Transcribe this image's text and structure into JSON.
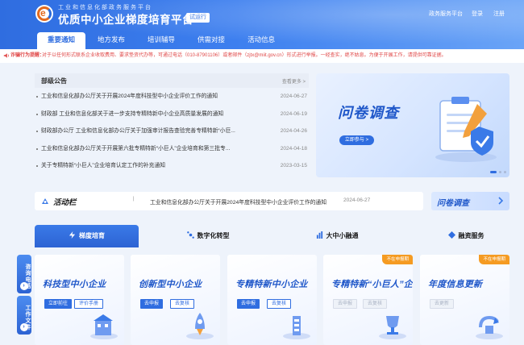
{
  "header": {
    "sup_title": "工业和信息化部政务服务平台",
    "title": "优质中小企业梯度培育平台",
    "badge": "试运行",
    "links": [
      "政务服务平台",
      "登录",
      "注册"
    ]
  },
  "nav": {
    "tabs": [
      "重要通知",
      "地方发布",
      "培训辅导",
      "供需对接",
      "活动信息"
    ],
    "active_index": 0
  },
  "notice": {
    "label": "诈骗行为提醒：",
    "text": "对于以任何形式联系企业收取费用、要求垫资代办等，可通过电话（010-87901106）或者邮件（zjtx@miit.gov.cn）形式进行举报。一经查实，绝不姑息。为便于开展工作，请提供可靠证据。"
  },
  "announcements": {
    "title": "部级公告",
    "more": "查看更多 >",
    "items": [
      {
        "title": "工业和信息化部办公厅关于开展2024年度科技型中小企业评价工作的通知",
        "date": "2024-06-27"
      },
      {
        "title": "财政部 工业和信息化部关于进一步支持专精特新中小企业高质量发展的通知",
        "date": "2024-06-19"
      },
      {
        "title": "财政部办公厅 工业和信息化部办公厅关于加强审计报告查验完善专精特新“小巨...",
        "date": "2024-04-26"
      },
      {
        "title": "工业和信息化部办公厅关于开展第六批专精特新“小巨人”企业培育和第三批专...",
        "date": "2024-04-18"
      },
      {
        "title": "关于专精特新“小巨人”企业培育认定工作的补充通知",
        "date": "2023-03-15"
      }
    ]
  },
  "banner": {
    "title": "问卷调查",
    "button": "立即参与 >",
    "slides": 3,
    "active_slide": 0
  },
  "activity": {
    "label": "活动栏",
    "separator": "|",
    "text": "工业和信息化部办公厅关于开展2024年度科技型中小企业评价工作的通知",
    "date": "2024-06-27"
  },
  "survey_mini": {
    "title": "问卷调查"
  },
  "categories": {
    "tabs": [
      "梯度培育",
      "数字化转型",
      "大中小融通",
      "融资服务"
    ],
    "active_index": 0
  },
  "cards": [
    {
      "title": "科技型中小企业",
      "buttons": [
        {
          "label": "立即前往",
          "style": "primary"
        },
        {
          "label": "评价手册",
          "style": "secondary"
        }
      ],
      "badge": ""
    },
    {
      "title": "创新型中小企业",
      "buttons": [
        {
          "label": "去申报",
          "style": "primary"
        },
        {
          "label": "去复核",
          "style": "secondary"
        }
      ],
      "badge": ""
    },
    {
      "title": "专精特新中小企业",
      "buttons": [
        {
          "label": "去申报",
          "style": "primary"
        },
        {
          "label": "去复核",
          "style": "secondary"
        }
      ],
      "badge": ""
    },
    {
      "title": "专精特新“小巨人”企业",
      "buttons": [
        {
          "label": "去申报",
          "style": "disabled"
        },
        {
          "label": "去复核",
          "style": "disabled"
        }
      ],
      "badge": "不在申报期"
    },
    {
      "title": "年度信息更新",
      "buttons": [
        {
          "label": "去更新",
          "style": "disabled"
        }
      ],
      "badge": "不在申报期"
    }
  ],
  "side_floats": [
    {
      "label": "咨询电话"
    },
    {
      "label": "工作文件"
    }
  ],
  "colors": {
    "primary": "#2f6de0",
    "notice_red": "#e04848",
    "badge_orange": "#f59b22",
    "background": "#eef3fb"
  }
}
